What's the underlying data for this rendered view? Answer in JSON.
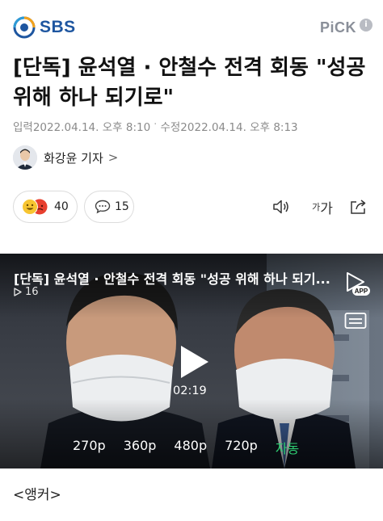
{
  "header": {
    "logo_text": "SBS",
    "pick_text": "PiCK",
    "pick_badge": "i"
  },
  "article": {
    "title": "[단독] 윤석열 · 안철수 전격 회동 \"성공 위해 하나 되기로\"",
    "input_date": "입력2022.04.14. 오후 8:10",
    "separator": "·",
    "modified_date": "수정2022.04.14. 오후 8:13",
    "reporter": "화강윤 기자",
    "reporter_chevron": ">"
  },
  "actions": {
    "reaction_count": "40",
    "comment_count": "15",
    "font_small": "가",
    "font_large": "가"
  },
  "video": {
    "title": "[단독] 윤석열 · 안철수 전격 회동 \"성공 위해 하나 되기...",
    "views": "16",
    "app_badge": "APP",
    "duration": "02:19",
    "qualities": [
      "270p",
      "360p",
      "480p",
      "720p",
      "자동"
    ],
    "selected_quality": "자동"
  },
  "body": {
    "first_line": "<앵커>"
  },
  "colors": {
    "brand_blue": "#1e56a0",
    "active_quality": "#2ecc71"
  }
}
